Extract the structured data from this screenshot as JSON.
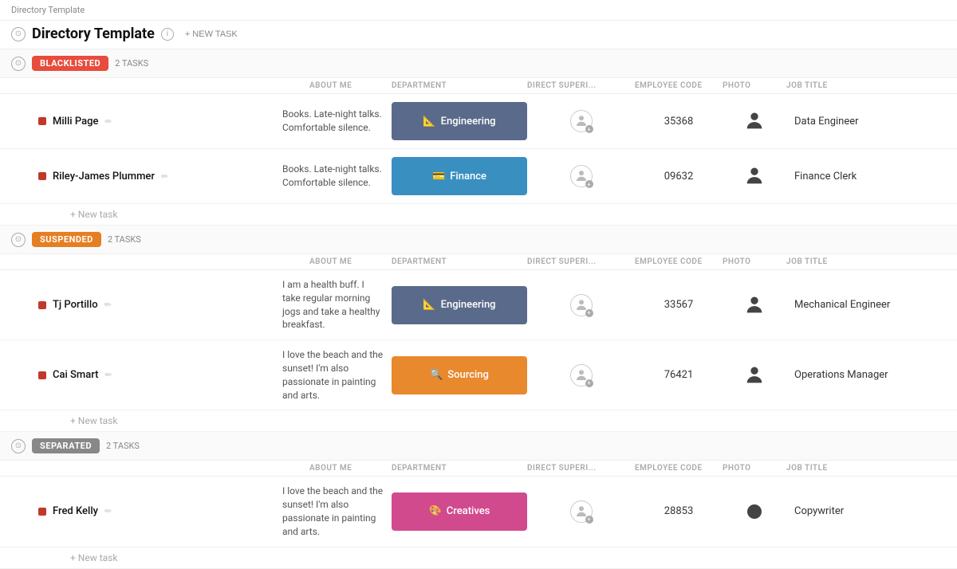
{
  "breadcrumb": "Directory Template",
  "header": {
    "title": "Directory Template",
    "new_task_label": "+ NEW TASK"
  },
  "sections": [
    {
      "id": "blacklisted",
      "badge_label": "BLACKLISTED",
      "badge_class": "badge-blacklisted",
      "badge_icon": "🔴",
      "task_count": "2 TASKS",
      "columns": [
        "ABOUT ME",
        "DEPARTMENT",
        "DIRECT SUPERI...",
        "EMPLOYEE CODE",
        "PHOTO",
        "JOB TITLE"
      ],
      "rows": [
        {
          "name": "Milli Page",
          "about": "Books. Late-night talks. Comfortable silence.",
          "dept_label": "Engineering",
          "dept_class": "dept-engineering",
          "dept_icon": "📐",
          "emp_code": "35368",
          "job_title": "Data Engineer"
        },
        {
          "name": "Riley-James Plummer",
          "about": "Books. Late-night talks. Comfortable silence.",
          "dept_label": "Finance",
          "dept_class": "dept-finance",
          "dept_icon": "💳",
          "emp_code": "09632",
          "job_title": "Finance Clerk"
        }
      ]
    },
    {
      "id": "suspended",
      "badge_label": "SUSPENDED",
      "badge_class": "badge-suspended",
      "badge_icon": "🔶",
      "task_count": "2 TASKS",
      "columns": [
        "ABOUT ME",
        "DEPARTMENT",
        "DIRECT SUPERI...",
        "EMPLOYEE CODE",
        "PHOTO",
        "JOB TITLE"
      ],
      "rows": [
        {
          "name": "Tj Portillo",
          "about": "I am a health buff. I take regular morning jogs and take a healthy breakfast.",
          "dept_label": "Engineering",
          "dept_class": "dept-engineering",
          "dept_icon": "📐",
          "emp_code": "33567",
          "job_title": "Mechanical Engineer"
        },
        {
          "name": "Cai Smart",
          "about": "I love the beach and the sunset! I'm also passionate in painting and arts.",
          "dept_label": "Sourcing",
          "dept_class": "dept-sourcing",
          "dept_icon": "🔍",
          "emp_code": "76421",
          "job_title": "Operations Manager"
        }
      ]
    },
    {
      "id": "separated",
      "badge_label": "SEPARATED",
      "badge_class": "badge-separated",
      "badge_icon": "❌",
      "task_count": "2 TASKS",
      "columns": [
        "ABOUT ME",
        "DEPARTMENT",
        "DIRECT SUPERI...",
        "EMPLOYEE CODE",
        "PHOTO",
        "JOB TITLE"
      ],
      "rows": [
        {
          "name": "Fred Kelly",
          "about": "I love the beach and the sunset! I'm also passionate in painting and arts.",
          "dept_label": "Creatives",
          "dept_class": "dept-creatives",
          "dept_icon": "🎨",
          "emp_code": "28853",
          "job_title": "Copywriter"
        }
      ]
    }
  ],
  "new_task_label": "+ New task"
}
